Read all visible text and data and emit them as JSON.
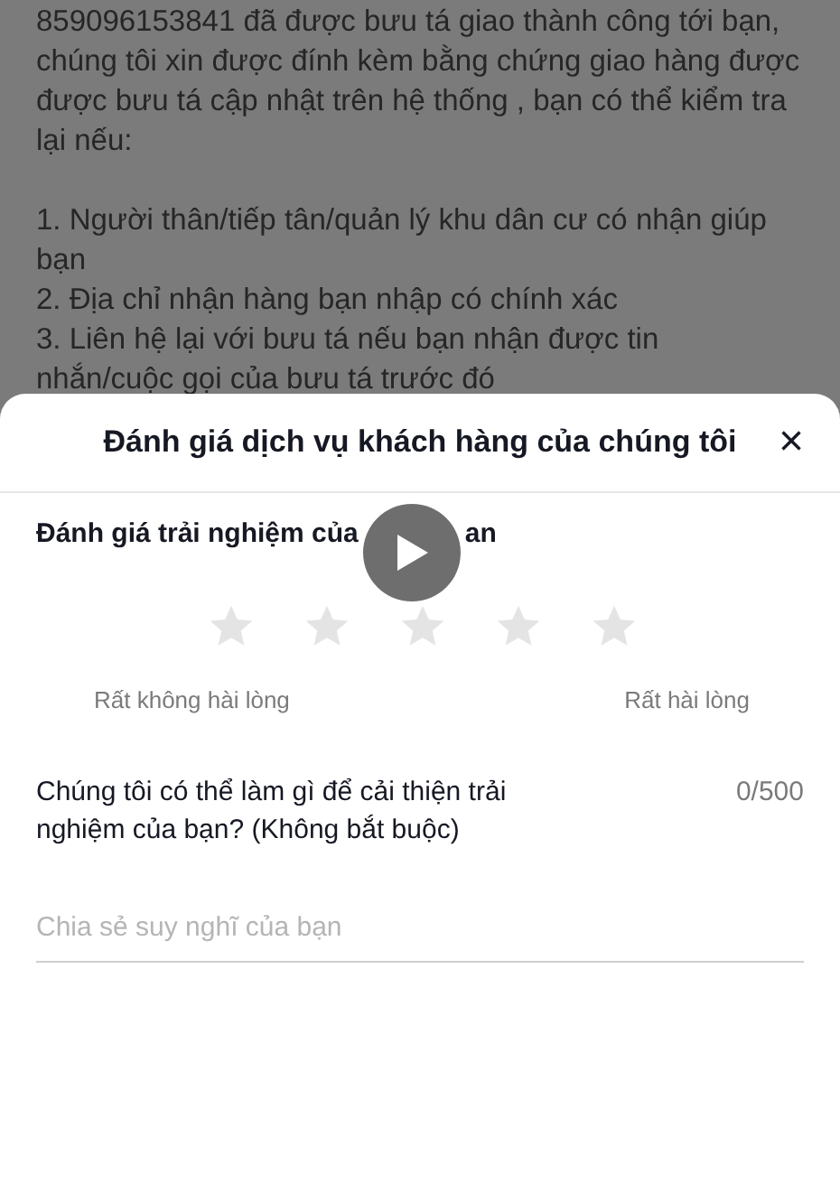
{
  "background_message": {
    "paragraph": "859096153841 đã được bưu tá giao thành công tới bạn, chúng tôi xin được đính kèm bằng chứng giao hàng được được bưu tá cập nhật trên hệ thống , bạn có thể kiểm tra lại nếu:",
    "list": [
      "1. Người thân/tiếp tân/quản lý khu dân cư có nhận giúp bạn",
      "2. Địa chỉ nhận hàng bạn nhập có chính xác",
      "3. Liên hệ lại với bưu tá nếu bạn nhận được tin nhắn/cuộc gọi của bưu tá trước đó"
    ]
  },
  "rating_sheet": {
    "title": "Đánh giá dịch vụ khách hàng của chúng tôi",
    "close": "×",
    "rating_label": "Đánh giá trải nghiệm của",
    "rating_label_tail": "an",
    "stars": 0,
    "low_label": "Rất không hài lòng",
    "high_label": "Rất hài lòng",
    "question": "Chúng tôi có thể làm gì để cải thiện trải nghiệm của bạn? (Không bắt buộc)",
    "counter": "0/500",
    "placeholder": "Chia sẻ suy nghĩ của bạn"
  },
  "video_overlay": {
    "kind": "play"
  }
}
